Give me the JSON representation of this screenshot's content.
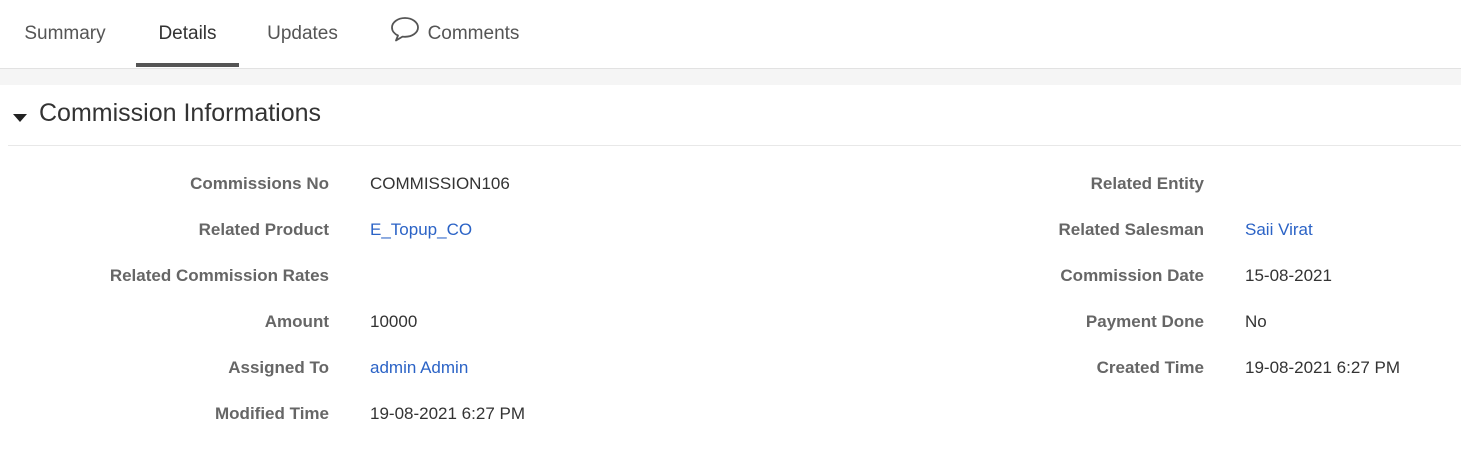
{
  "tabs": [
    {
      "label": "Summary",
      "active": false
    },
    {
      "label": "Details",
      "active": true
    },
    {
      "label": "Updates",
      "active": false
    },
    {
      "label": "Comments",
      "active": false,
      "icon": "speech-bubble-icon"
    }
  ],
  "block": {
    "title": "Commission Informations",
    "toggle_icon": "caret-down-icon"
  },
  "fields_left": [
    {
      "label": "Commissions No",
      "value": "COMMISSION106",
      "link": false
    },
    {
      "label": "Related Product",
      "value": "E_Topup_CO",
      "link": true
    },
    {
      "label": "Related Commission Rates",
      "value": "",
      "link": false
    },
    {
      "label": "Amount",
      "value": "10000",
      "link": false
    },
    {
      "label": "Assigned To",
      "value": "admin Admin",
      "link": true
    },
    {
      "label": "Modified Time",
      "value": "19-08-2021 6:27 PM",
      "link": false
    }
  ],
  "fields_right": [
    {
      "label": "Related Entity",
      "value": "",
      "link": false
    },
    {
      "label": "Related Salesman",
      "value": "Saii Virat",
      "link": true
    },
    {
      "label": "Commission Date",
      "value": "15-08-2021",
      "link": false
    },
    {
      "label": "Payment Done",
      "value": "No",
      "link": false
    },
    {
      "label": "Created Time",
      "value": "19-08-2021 6:27 PM",
      "link": false
    }
  ],
  "colors": {
    "link": "#2b63c6",
    "label": "#666666",
    "active_tab_underline": "#555555"
  }
}
